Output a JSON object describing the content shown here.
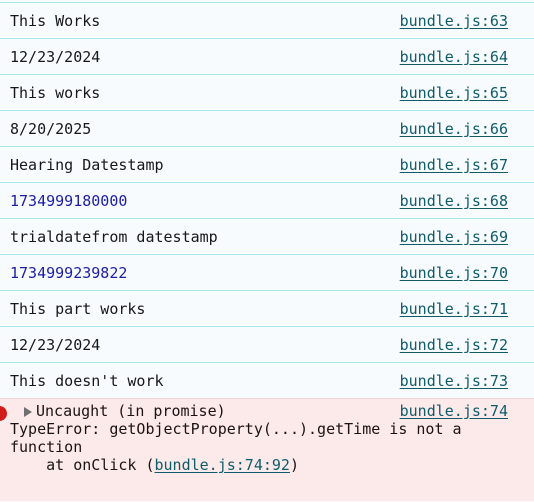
{
  "console": {
    "rows": [
      {
        "message": "This Works",
        "kind": "text",
        "source": "bundle.js:63"
      },
      {
        "message": "12/23/2024",
        "kind": "text",
        "source": "bundle.js:64"
      },
      {
        "message": "This works",
        "kind": "text",
        "source": "bundle.js:65"
      },
      {
        "message": "8/20/2025",
        "kind": "text",
        "source": "bundle.js:66"
      },
      {
        "message": "Hearing Datestamp",
        "kind": "text",
        "source": "bundle.js:67"
      },
      {
        "message": "1734999180000",
        "kind": "number",
        "source": "bundle.js:68"
      },
      {
        "message": "trialdatefrom datestamp",
        "kind": "text",
        "source": "bundle.js:69"
      },
      {
        "message": "1734999239822",
        "kind": "number",
        "source": "bundle.js:70"
      },
      {
        "message": "This part works",
        "kind": "text",
        "source": "bundle.js:71"
      },
      {
        "message": "12/23/2024",
        "kind": "text",
        "source": "bundle.js:72"
      },
      {
        "message": "This doesn't work",
        "kind": "text",
        "source": "bundle.js:73"
      }
    ],
    "error": {
      "badge_icon": "error-circle-icon",
      "expander_icon": "disclosure-triangle-right-icon",
      "headline": "Uncaught (in promise)",
      "source": "bundle.js:74",
      "detail": "TypeError: getObjectProperty(...).getTime is not a function",
      "stack_prefix": "    at onClick (",
      "stack_link": "bundle.js:74:92",
      "stack_suffix": ")"
    },
    "colors": {
      "background": "#f7fbfd",
      "row_separator": "#a8e6f2",
      "text": "#18181b",
      "number": "#1d1da8",
      "link": "#0f5b6a",
      "error_background": "#fbeae9",
      "error_badge": "#d11b1b"
    }
  }
}
